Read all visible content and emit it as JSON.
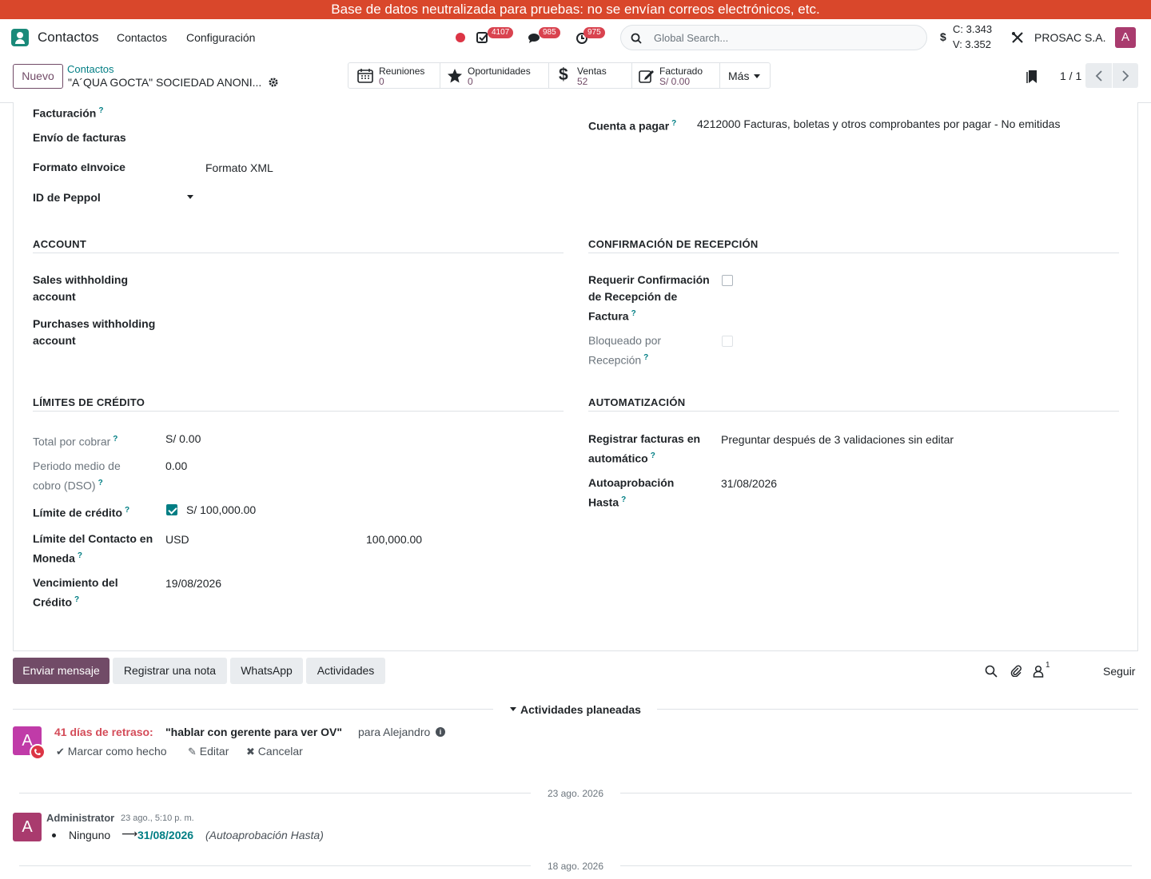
{
  "banner": {
    "text": "Base de datos neutralizada para pruebas: no se envían correos electrónicos, etc."
  },
  "navbar": {
    "app_title": "Contactos",
    "menu": [
      "Contactos",
      "Configuración"
    ],
    "activity_count": "4107",
    "messages_count": "985",
    "timer_count": "975",
    "search_placeholder": "Global Search...",
    "currency_symbol": "$",
    "rate_c": "C: 3.343",
    "rate_v": "V: 3.352",
    "company": "PROSAC S.A.",
    "user_initial": "A"
  },
  "control": {
    "new_button": "Nuevo",
    "breadcrumb_parent": "Contactos",
    "record_name": "\"A´QUA GOCTA\" SOCIEDAD ANONI...",
    "smart_buttons": [
      {
        "label": "Reuniones",
        "value": "0",
        "icon": "calendar-icon"
      },
      {
        "label": "Oportunidades",
        "value": "0",
        "icon": "star-icon"
      },
      {
        "label": "Ventas",
        "value": "52",
        "icon": "dollar-icon"
      },
      {
        "label": "Facturado",
        "value": "S/ 0.00",
        "icon": "edit-icon"
      }
    ],
    "more_button": "Más",
    "pager": "1 / 1"
  },
  "form": {
    "facturacion_label": "Facturación",
    "envio_facturas_label": "Envío de facturas",
    "formato_label": "Formato eInvoice",
    "formato_value": "Formato XML",
    "peppol_label": "ID de Peppol",
    "cuenta_pagar_label": "Cuenta a pagar",
    "cuenta_pagar_value": "4212000 Facturas, boletas y otros comprobantes por pagar - No emitidas",
    "account_section": "ACCOUNT",
    "sales_withholding_label_1": "Sales withholding",
    "sales_withholding_label_2": "account",
    "purchases_withholding_label_1": "Purchases withholding",
    "purchases_withholding_label_2": "account",
    "confirmacion_section": "CONFIRMACIÓN DE RECEPCIÓN",
    "requerir_label_1": "Requerir Confirmación",
    "requerir_label_2": "de Recepción de",
    "requerir_label_3": "Factura",
    "requerir_checked": false,
    "bloqueado_label_1": "Bloqueado por",
    "bloqueado_label_2": "Recepción",
    "bloqueado_checked": false,
    "limites_section": "LÍMITES DE CRÉDITO",
    "total_cobrar_label": "Total por cobrar",
    "total_cobrar_value": "S/ 0.00",
    "dso_label_1": "Periodo medio de",
    "dso_label_2": "cobro (DSO)",
    "dso_value": "0.00",
    "limite_credito_label": "Límite de crédito",
    "limite_credito_checked": true,
    "limite_credito_value": "S/ 100,000.00",
    "limite_moneda_label_1": "Límite del Contacto en",
    "limite_moneda_label_2": "Moneda",
    "limite_moneda_currency": "USD",
    "limite_moneda_value": "100,000.00",
    "vencimiento_label_1": "Vencimiento del",
    "vencimiento_label_2": "Crédito",
    "vencimiento_value": "19/08/2026",
    "automatizacion_section": "AUTOMATIZACIÓN",
    "registrar_label_1": "Registrar facturas en",
    "registrar_label_2": "automático",
    "registrar_value": "Preguntar después de 3 validaciones sin editar",
    "autoaprobacion_label_1": "Autoaprobación",
    "autoaprobacion_label_2": "Hasta",
    "autoaprobacion_value": "31/08/2026"
  },
  "chatter": {
    "send_message": "Enviar mensaje",
    "log_note": "Registrar una nota",
    "whatsapp": "WhatsApp",
    "activities": "Actividades",
    "followers_count": "1",
    "follow": "Seguir",
    "planned_header": "Actividades planeadas",
    "activity": {
      "late_text": "41 días de retraso:",
      "summary": "\"hablar con gerente para ver OV\"",
      "assignee": "para Alejandro",
      "mark_done": "Marcar como hecho",
      "edit": "Editar",
      "cancel": "Cancelar",
      "avatar_initial": "A"
    },
    "date_separator_1": "23 ago. 2026",
    "message": {
      "author": "Administrator",
      "datetime": "23 ago., 5:10 p. m.",
      "old_value": "Ninguno",
      "new_value": "31/08/2026",
      "field": "(Autoaprobación Hasta)",
      "avatar_initial": "A"
    },
    "date_separator_2": "18 ago. 2026"
  }
}
